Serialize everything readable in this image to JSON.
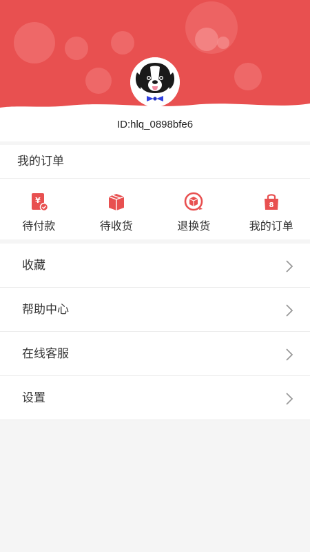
{
  "profile": {
    "user_id": "ID:hlq_0898bfe6"
  },
  "orders": {
    "title": "我的订单",
    "items": [
      {
        "label": "待付款",
        "icon": "payment-pending-icon"
      },
      {
        "label": "待收货",
        "icon": "package-icon"
      },
      {
        "label": "退换货",
        "icon": "return-icon"
      },
      {
        "label": "我的订单",
        "icon": "shopping-bag-icon"
      }
    ]
  },
  "menu": {
    "items": [
      {
        "label": "收藏"
      },
      {
        "label": "帮助中心"
      },
      {
        "label": "在线客服"
      },
      {
        "label": "设置"
      }
    ]
  },
  "colors": {
    "brand_red": "#e85050",
    "background": "#f5f5f5"
  }
}
